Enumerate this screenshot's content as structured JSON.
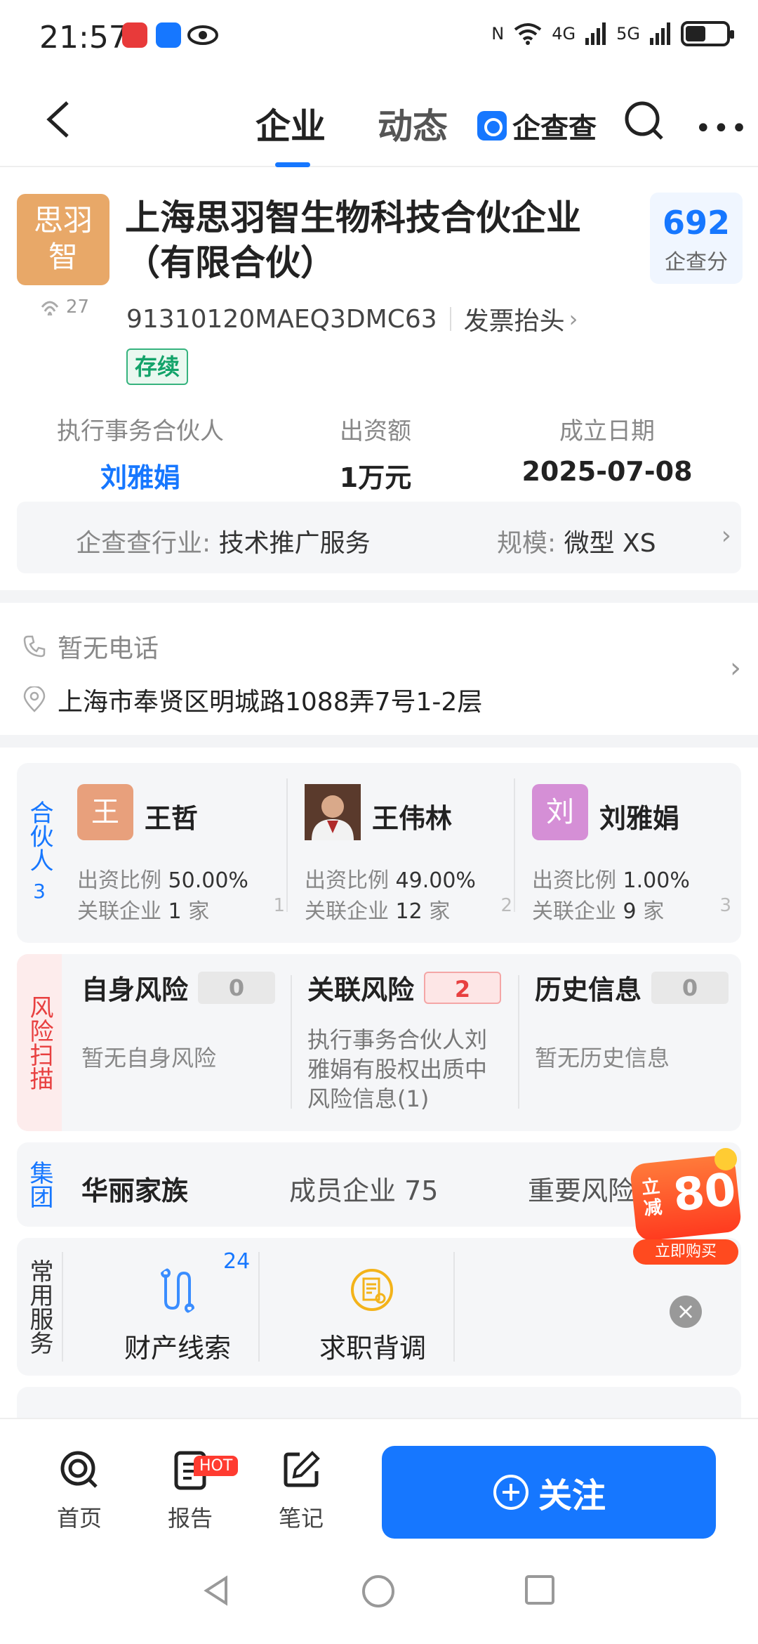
{
  "status_bar": {
    "time": "21:57",
    "signal_labels": [
      "4G",
      "5G"
    ]
  },
  "nav": {
    "tabs": [
      {
        "label": "企业",
        "active": true
      },
      {
        "label": "动态",
        "active": false
      }
    ],
    "brand": "企查查"
  },
  "company": {
    "logo_text_line1": "思羽",
    "logo_text_line2": "智",
    "views": "27",
    "name": "上海思羽智生物科技合伙企业（有限合伙）",
    "credit_code": "91310120MAEQ3DMC63",
    "invoice_label": "发票抬头",
    "status": "存续",
    "score_value": "692",
    "score_label": "企查分"
  },
  "info": [
    {
      "label": "执行事务合伙人",
      "value": "刘雅娟",
      "is_link": true
    },
    {
      "label": "出资额",
      "value": "1万元",
      "is_link": false
    },
    {
      "label": "成立日期",
      "value": "2025-07-08",
      "is_link": false
    }
  ],
  "industry": {
    "label": "企查查行业:",
    "value": "技术推广服务",
    "scale_label": "规模:",
    "scale_value": "微型 XS"
  },
  "contact": {
    "phone": "暂无电话",
    "address": "上海市奉贤区明城路1088弄7号1-2层"
  },
  "partners": {
    "section_label": "合伙人",
    "count": "3",
    "ratio_label": "出资比例",
    "related_label": "关联企业",
    "unit": "家",
    "items": [
      {
        "avatar_text": "王",
        "name": "王哲",
        "ratio": "50.00%",
        "related": "1",
        "index": "1",
        "avatar_color": "#e8a07c"
      },
      {
        "avatar_text": "",
        "name": "王伟林",
        "ratio": "49.00%",
        "related": "12",
        "index": "2",
        "avatar_color": "#6b4a3a"
      },
      {
        "avatar_text": "刘",
        "name": "刘雅娟",
        "ratio": "1.00%",
        "related": "9",
        "index": "3",
        "avatar_color": "#d58fd6"
      }
    ]
  },
  "risk": {
    "section_label": "风险扫描",
    "items": [
      {
        "title": "自身风险",
        "count": "0",
        "desc": "暂无自身风险",
        "alert": false
      },
      {
        "title": "关联风险",
        "count": "2",
        "desc": "执行事务合伙人刘雅娟有股权出质中风险信息(1)",
        "alert": true
      },
      {
        "title": "历史信息",
        "count": "0",
        "desc": "暂无历史信息",
        "alert": false
      }
    ]
  },
  "group": {
    "section_label": "集团",
    "name": "华丽家族",
    "members": "成员企业 75",
    "risk": "重要风险"
  },
  "services": {
    "section_label": "常用服务",
    "badge": "24",
    "items": [
      {
        "label": "财产线索",
        "icon": "route-icon"
      },
      {
        "label": "求职背调",
        "icon": "document-search-icon"
      }
    ]
  },
  "promo": {
    "prefix": "立减",
    "amount": "80",
    "cta": "立即购买"
  },
  "bottom_nav": {
    "items": [
      {
        "label": "首页",
        "icon": "home-logo-icon"
      },
      {
        "label": "报告",
        "icon": "report-icon"
      },
      {
        "label": "笔记",
        "icon": "note-icon"
      }
    ],
    "hot_badge": "HOT",
    "follow_label": "关注"
  },
  "colors": {
    "accent": "#1677ff",
    "risk_red": "#e84040",
    "status_green": "#13a36a"
  }
}
